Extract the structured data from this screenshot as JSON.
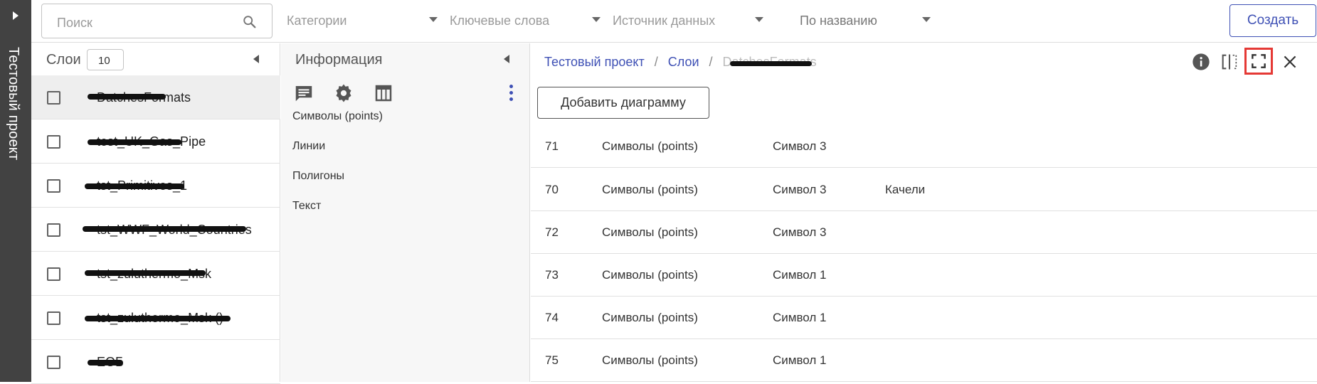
{
  "rail": {
    "title": "Тестовый проект"
  },
  "topbar": {
    "search_placeholder": "Поиск",
    "filters": [
      "Категории",
      "Ключевые слова",
      "Источник данных",
      "По названию"
    ],
    "create_label": "Создать"
  },
  "layers": {
    "title": "Слои",
    "page_size": "10",
    "items": [
      {
        "label": "DatchesFormats"
      },
      {
        "label": "test_UK_Gas_Pipe"
      },
      {
        "label": "tst_Primitives_1"
      },
      {
        "label": "tst_WWF_World_Countries"
      },
      {
        "label": "tst_zuluthermo_Msk"
      },
      {
        "label": "tst_zuluthermo_Msk ()"
      },
      {
        "label": "ЕОБ"
      }
    ]
  },
  "info": {
    "title": "Информация",
    "items": [
      "Символы (points)",
      "Линии",
      "Полигоны",
      "Текст"
    ]
  },
  "main": {
    "breadcrumb": [
      "Тестовый проект",
      "Слои",
      "DatchesFormats"
    ],
    "add_chart_label": "Добавить диаграмму",
    "rows": [
      {
        "id": "71",
        "type": "Символы (points)",
        "symbol": "Символ 3",
        "name": ""
      },
      {
        "id": "70",
        "type": "Символы (points)",
        "symbol": "Символ 3",
        "name": "Качели"
      },
      {
        "id": "72",
        "type": "Символы (points)",
        "symbol": "Символ 3",
        "name": ""
      },
      {
        "id": "73",
        "type": "Символы (points)",
        "symbol": "Символ 1",
        "name": ""
      },
      {
        "id": "74",
        "type": "Символы (points)",
        "symbol": "Символ 1",
        "name": ""
      },
      {
        "id": "75",
        "type": "Символы (points)",
        "symbol": "Символ 1",
        "name": ""
      }
    ]
  },
  "colors": {
    "accent": "#3f51b5",
    "rail": "#424242",
    "highlight": "#e53935"
  }
}
